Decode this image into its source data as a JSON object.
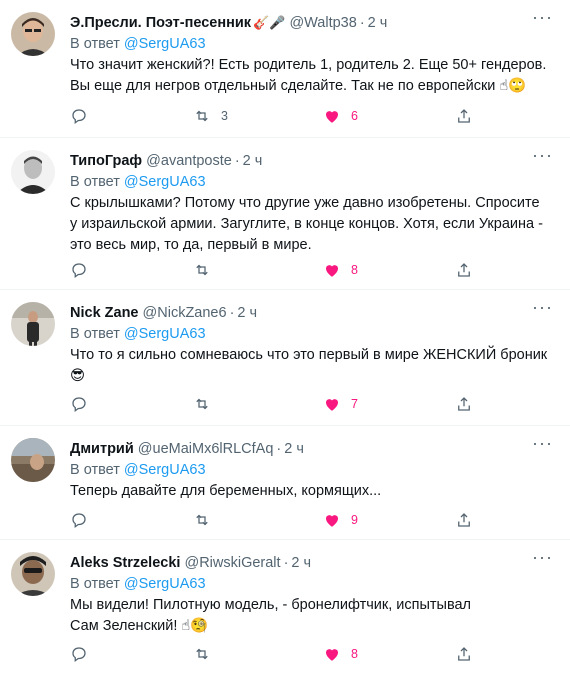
{
  "tweets": [
    {
      "name": "Э.Пресли. Поэт-песенник",
      "name_emoji": "🎸🎤",
      "handle": "@Waltp38",
      "time": "2 ч",
      "reply_label": "В ответ",
      "reply_to": "@SergUA63",
      "text": "Что значит женский?! Есть родитель 1, родитель 2. Еще 50+ гендеров. Вы еще для негров отдельный сделайте. Так не по европейски ☝",
      "text_emoji": "🙄",
      "retweets": "3",
      "likes": "6",
      "avatar_icon": "user-avatar-icon"
    },
    {
      "name": "ТипоГраф",
      "handle": "@avantposte",
      "time": "2 ч",
      "reply_label": "В ответ",
      "reply_to": "@SergUA63",
      "text": "С крылышками? Потому что другие уже давно изобретены. Спросите у израильской армии. Загуглите, в конце концов. Хотя, если Украина - это весь мир, то да, первый в мире.",
      "retweets": "",
      "likes": "8",
      "avatar_icon": "user-avatar-icon"
    },
    {
      "name": "Nick Zane",
      "handle": "@NickZane6",
      "time": "2 ч",
      "reply_label": "В ответ",
      "reply_to": "@SergUA63",
      "text": "Что то я сильно сомневаюсь что это первый в мире ЖЕНСКИЙ броник",
      "text_emoji": "😎",
      "retweets": "",
      "likes": "7",
      "avatar_icon": "user-avatar-icon"
    },
    {
      "name": "Дмитрий",
      "handle": "@ueMaiMx6lRLCfAq",
      "time": "2 ч",
      "reply_label": "В ответ",
      "reply_to": "@SergUA63",
      "text": "Теперь давайте для беременных, кормящих...",
      "retweets": "",
      "likes": "9",
      "avatar_icon": "user-avatar-icon"
    },
    {
      "name": "Aleks Strzelecki",
      "handle": "@RiwskiGeralt",
      "time": "2 ч",
      "reply_label": "В ответ",
      "reply_to": "@SergUA63",
      "text": "Мы видели! Пилотную модель, - бронелифтчик, испытывал Сам Зеленский! ☝",
      "text_emoji": "🧐",
      "retweets": "",
      "likes": "8",
      "avatar_icon": "user-avatar-icon"
    }
  ],
  "icons": {
    "reply": "reply-icon",
    "retweet": "retweet-icon",
    "like": "heart-icon",
    "share": "share-icon",
    "more": "more-icon"
  },
  "colors": {
    "accent": "#1d9bf0",
    "like": "#f91880",
    "muted": "#536471",
    "text": "#0f1419",
    "divider": "#eff3f4"
  }
}
